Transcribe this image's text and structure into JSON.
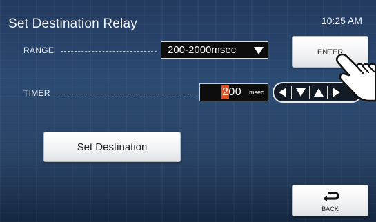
{
  "header": {
    "title": "Set Destination Relay",
    "time": "10:25 AM"
  },
  "range": {
    "label": "RANGE",
    "value": "200-2000msec"
  },
  "timer": {
    "label": "TIMER",
    "highlighted_digit": "2",
    "rest_digits": "00",
    "unit": "msec"
  },
  "buttons": {
    "enter": "ENTER",
    "set_destination": "Set Destination",
    "back": "BACK"
  },
  "icons": {
    "range_dropdown": "triangle-down-icon",
    "timer_left": "arrow-left-icon",
    "timer_down": "arrow-down-icon",
    "timer_up": "arrow-up-icon",
    "timer_right": "arrow-right-icon",
    "back": "back-arrow-icon",
    "hand": "pointing-hand-icon"
  },
  "colors": {
    "background": "#243a5f",
    "digit_highlight": "#e0501e",
    "field_bg": "#0d0d0d"
  }
}
